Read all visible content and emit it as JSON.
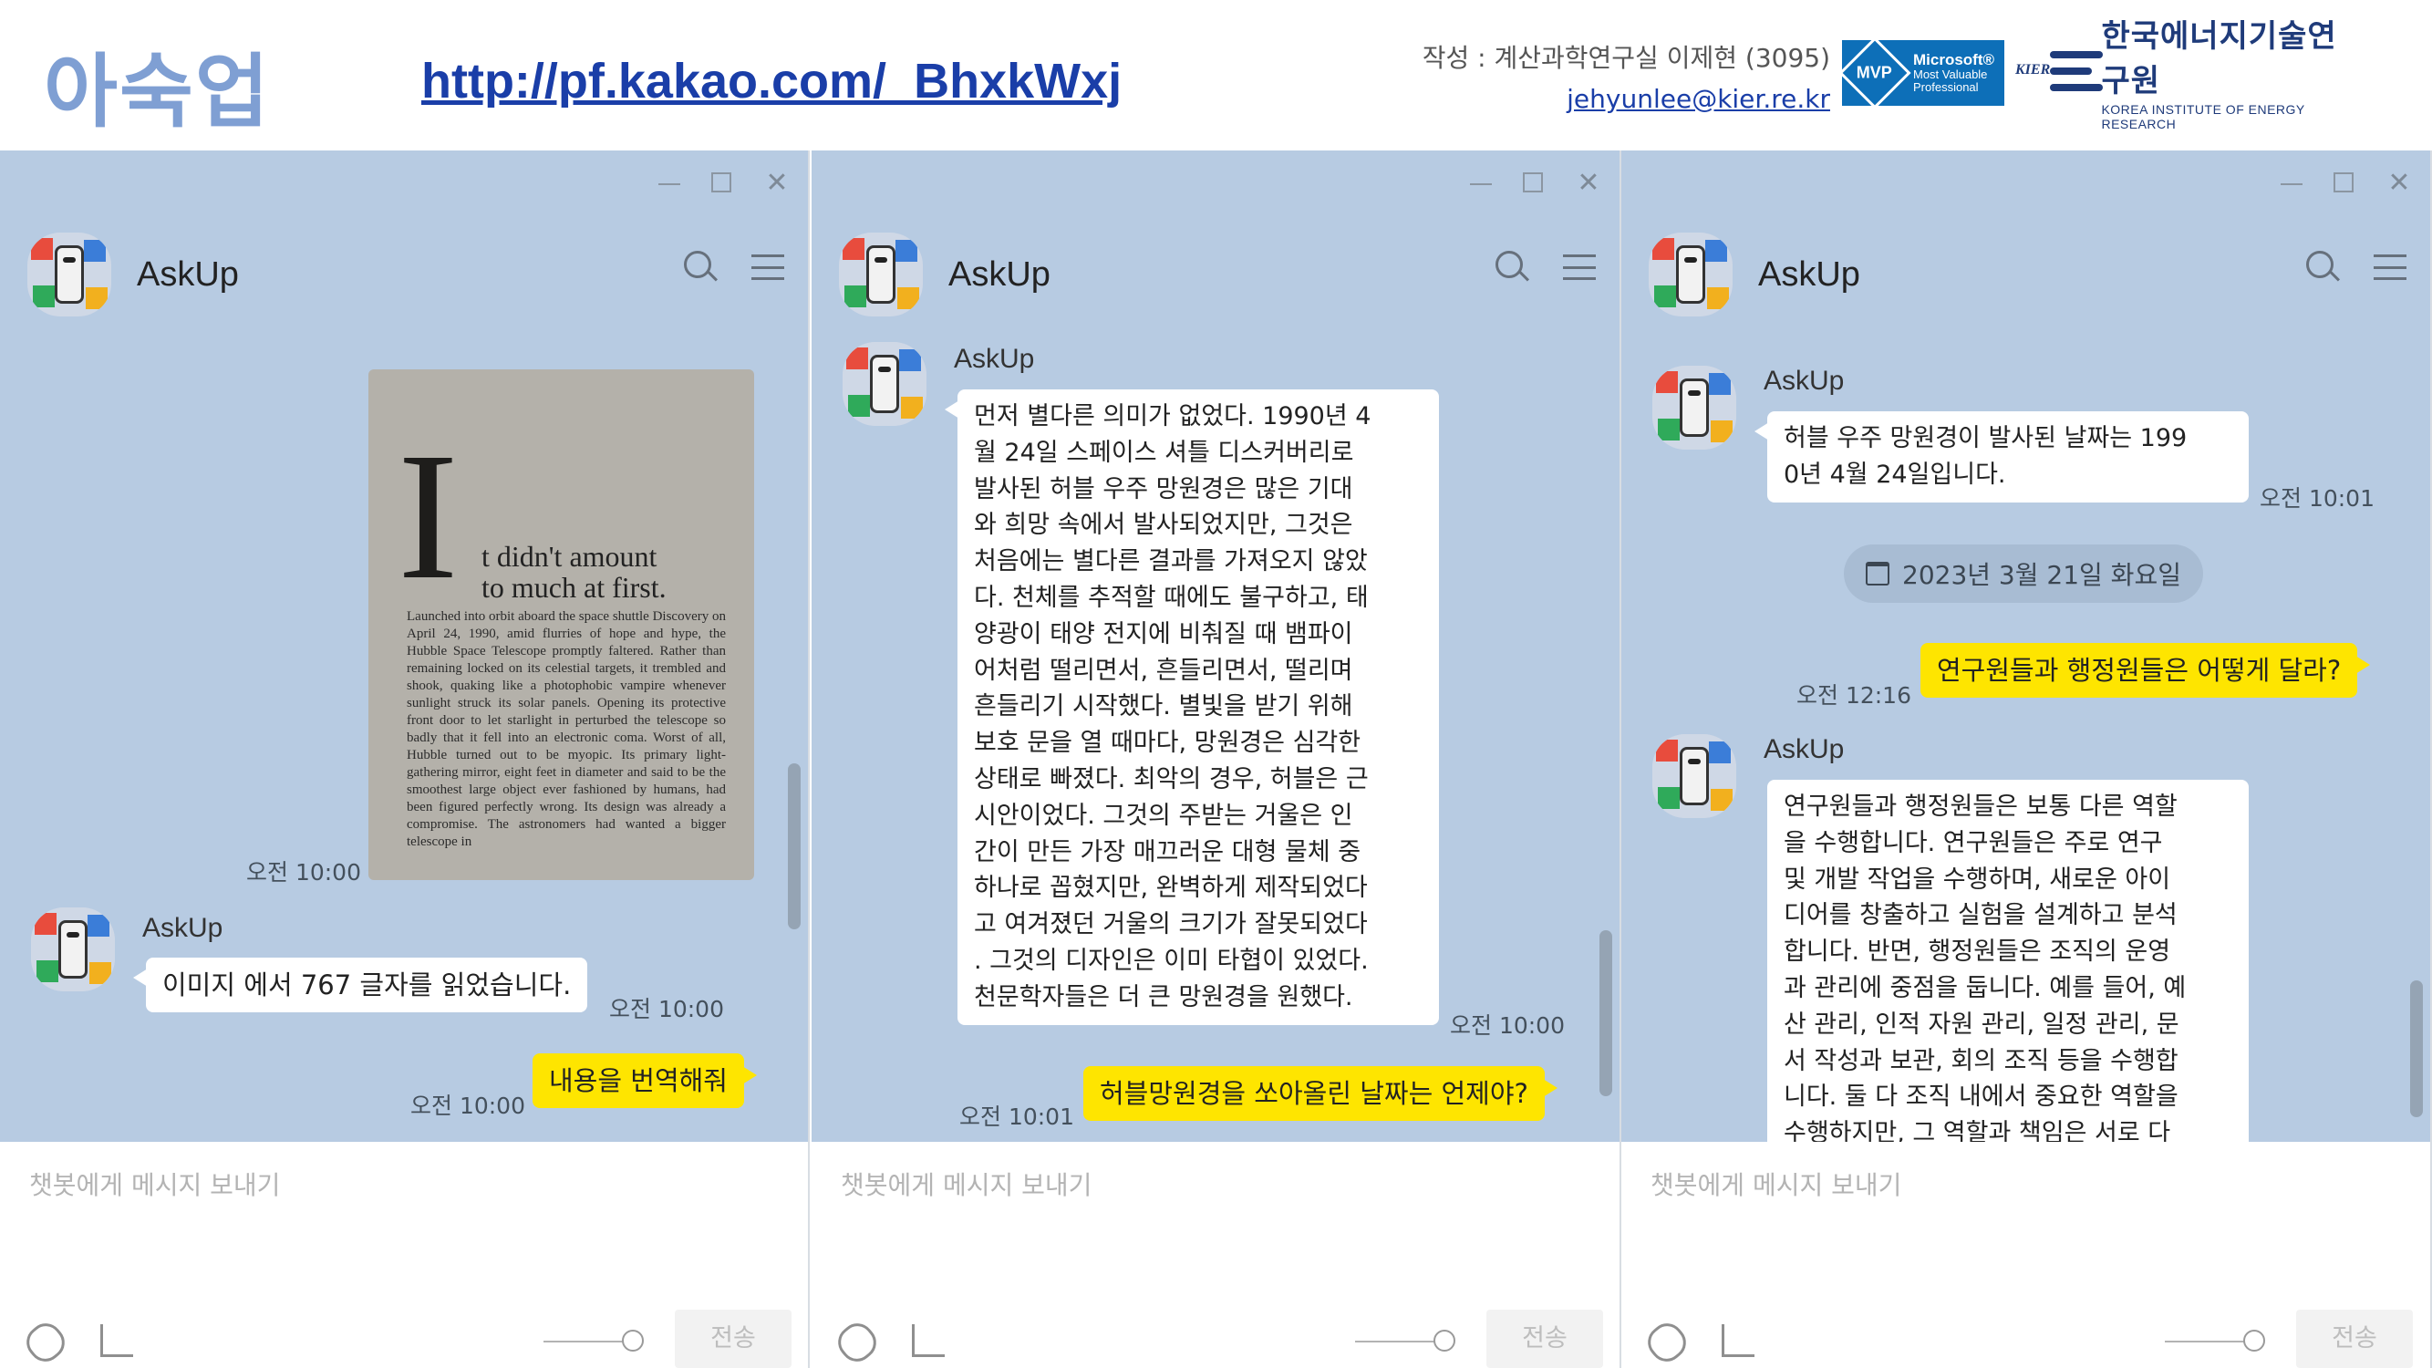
{
  "slide": {
    "title": "아숙업",
    "link": "http://pf.kakao.com/_BhxkWxj",
    "author": "작성 : 계산과학연구실 이제현 (3095)",
    "email": "jehyunlee@kier.re.kr",
    "mvp_badge": {
      "mark": "MVP",
      "line1": "Microsoft®",
      "line2": "Most Valuable",
      "line3": "Professional"
    },
    "org_logo": {
      "mark": "KIER",
      "name_ko": "한국에너지기술연구원",
      "name_en": "KOREA INSTITUTE OF ENERGY RESEARCH"
    }
  },
  "window_controls": {
    "minimize": "—",
    "maximize": "☐",
    "close": "✕"
  },
  "chat_name": "AskUp",
  "input_placeholder": "챗봇에게 메시지 보내기",
  "send_label": "전송",
  "panel1": {
    "photo_caption": {
      "big_letter": "I",
      "lead_line1": "t didn't amount",
      "lead_line2": "to much at first.",
      "body": "Launched into orbit aboard the space shuttle Discovery on April 24, 1990, amid flurries of hope and hype, the Hubble Space Telescope promptly faltered. Rather than remaining locked on its celestial targets, it trembled and shook, quaking like a photophobic vampire whenever sunlight struck its solar panels. Opening its protective front door to let starlight in perturbed the telescope so badly that it fell into an electronic coma. Worst of all, Hubble turned out to be myopic. Its primary light-gathering mirror, eight feet in diameter and said to be the smoothest large object ever fashioned by humans, had been figured perfectly wrong. Its design was already a compromise. The astronomers had wanted a bigger telescope in"
    },
    "photo_time": "오전 10:00",
    "bot_label": "AskUp",
    "bot_msg": "이미지 에서 767 글자를 읽었습니다.",
    "bot_time": "오전 10:00",
    "user_msg": "내용을 번역해줘",
    "user_time": "오전 10:00"
  },
  "panel2": {
    "bot_label": "AskUp",
    "bot_lines": [
      "먼저 별다른 의미가 없었다. 1990년 4",
      "월 24일 스페이스 셔틀 디스커버리로",
      "발사된 허블 우주 망원경은 많은 기대",
      "와 희망 속에서 발사되었지만, 그것은",
      "처음에는 별다른 결과를 가져오지 않았",
      "다. 천체를 추적할 때에도 불구하고, 태",
      "양광이 태양 전지에 비춰질 때 뱀파이",
      "어처럼 떨리면서, 흔들리면서, 떨리며",
      "흔들리기 시작했다. 별빛을 받기 위해",
      "보호 문을 열 때마다, 망원경은 심각한",
      "상태로 빠졌다. 최악의 경우, 허블은 근",
      "시안이었다. 그것의 주받는 거울은 인",
      "간이 만든 가장 매끄러운 대형 물체 중",
      "하나로 꼽혔지만, 완벽하게 제작되었다",
      "고 여겨졌던 거울의 크기가 잘못되었다",
      ". 그것의 디자인은 이미 타협이 있었다.",
      "천문학자들은 더 큰 망원경을 원했다."
    ],
    "bot_time": "오전 10:00",
    "user_msg": "허블망원경을 쏘아올린 날짜는 언제야?",
    "user_time": "오전 10:01"
  },
  "panel3": {
    "bot1_label": "AskUp",
    "bot1_lines": [
      "허블 우주 망원경이 발사된 날짜는 199",
      "0년 4월 24일입니다."
    ],
    "bot1_time": "오전 10:01",
    "date_divider": "2023년 3월 21일 화요일",
    "user_msg": "연구원들과 행정원들은 어떻게 달라?",
    "user_time": "오전 12:16",
    "bot2_label": "AskUp",
    "bot2_lines": [
      "연구원들과 행정원들은 보통 다른 역할",
      "을 수행합니다. 연구원들은 주로 연구",
      "및 개발 작업을 수행하며, 새로운 아이",
      "디어를 창출하고 실험을 설계하고 분석",
      "합니다. 반면, 행정원들은 조직의 운영",
      "과 관리에 중점을 둡니다. 예를 들어, 예",
      "산 관리, 인적 자원 관리, 일정 관리, 문",
      "서 작성과 보관, 회의 조직 등을 수행합",
      "니다. 둘 다 조직 내에서 중요한 역할을",
      "수행하지만, 그 역할과 책임은 서로 다"
    ]
  }
}
